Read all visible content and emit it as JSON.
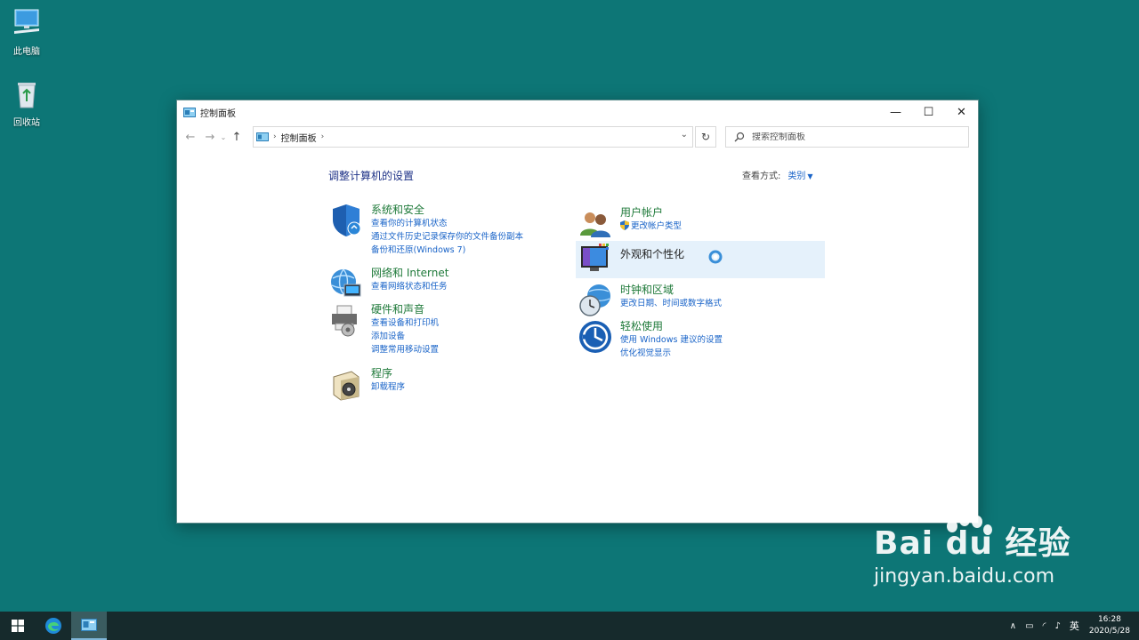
{
  "desktop": {
    "icons": [
      {
        "label": "此电脑",
        "icon": "this-pc-icon"
      },
      {
        "label": "回收站",
        "icon": "recycle-bin-icon"
      }
    ]
  },
  "window": {
    "title": "控制面板",
    "breadcrumb": "控制面板",
    "search_placeholder": "搜索控制面板",
    "page_title": "调整计算机的设置",
    "view_by_label": "查看方式:",
    "view_by_value": "类别"
  },
  "categories": {
    "system": {
      "title": "系统和安全",
      "links": [
        "查看你的计算机状态",
        "通过文件历史记录保存你的文件备份副本",
        "备份和还原(Windows 7)"
      ],
      "icon": "shield-icon"
    },
    "network": {
      "title": "网络和 Internet",
      "links": [
        "查看网络状态和任务"
      ],
      "icon": "network-globe-icon"
    },
    "hardware": {
      "title": "硬件和声音",
      "links": [
        "查看设备和打印机",
        "添加设备",
        "调整常用移动设置"
      ],
      "icon": "printer-icon"
    },
    "programs": {
      "title": "程序",
      "links": [
        "卸载程序"
      ],
      "icon": "programs-icon"
    },
    "users": {
      "title": "用户帐户",
      "links": [
        "更改帐户类型"
      ],
      "icon": "users-icon"
    },
    "appearance": {
      "title": "外观和个性化",
      "links": [],
      "icon": "appearance-icon"
    },
    "clock": {
      "title": "时钟和区域",
      "links": [
        "更改日期、时间或数字格式"
      ],
      "icon": "clock-globe-icon"
    },
    "ease": {
      "title": "轻松使用",
      "links": [
        "使用 Windows 建议的设置",
        "优化视觉显示"
      ],
      "icon": "ease-of-access-icon"
    }
  },
  "taskbar": {
    "ime": "英",
    "time": "16:28",
    "date": "2020/5/28"
  },
  "watermark": {
    "brand": "Bai du 经验",
    "url": "jingyan.baidu.com"
  },
  "colors": {
    "desktop": "#0d7676",
    "category_title": "#1f7a3a",
    "link": "#1a64c8",
    "highlight": "#e5f1fb"
  }
}
